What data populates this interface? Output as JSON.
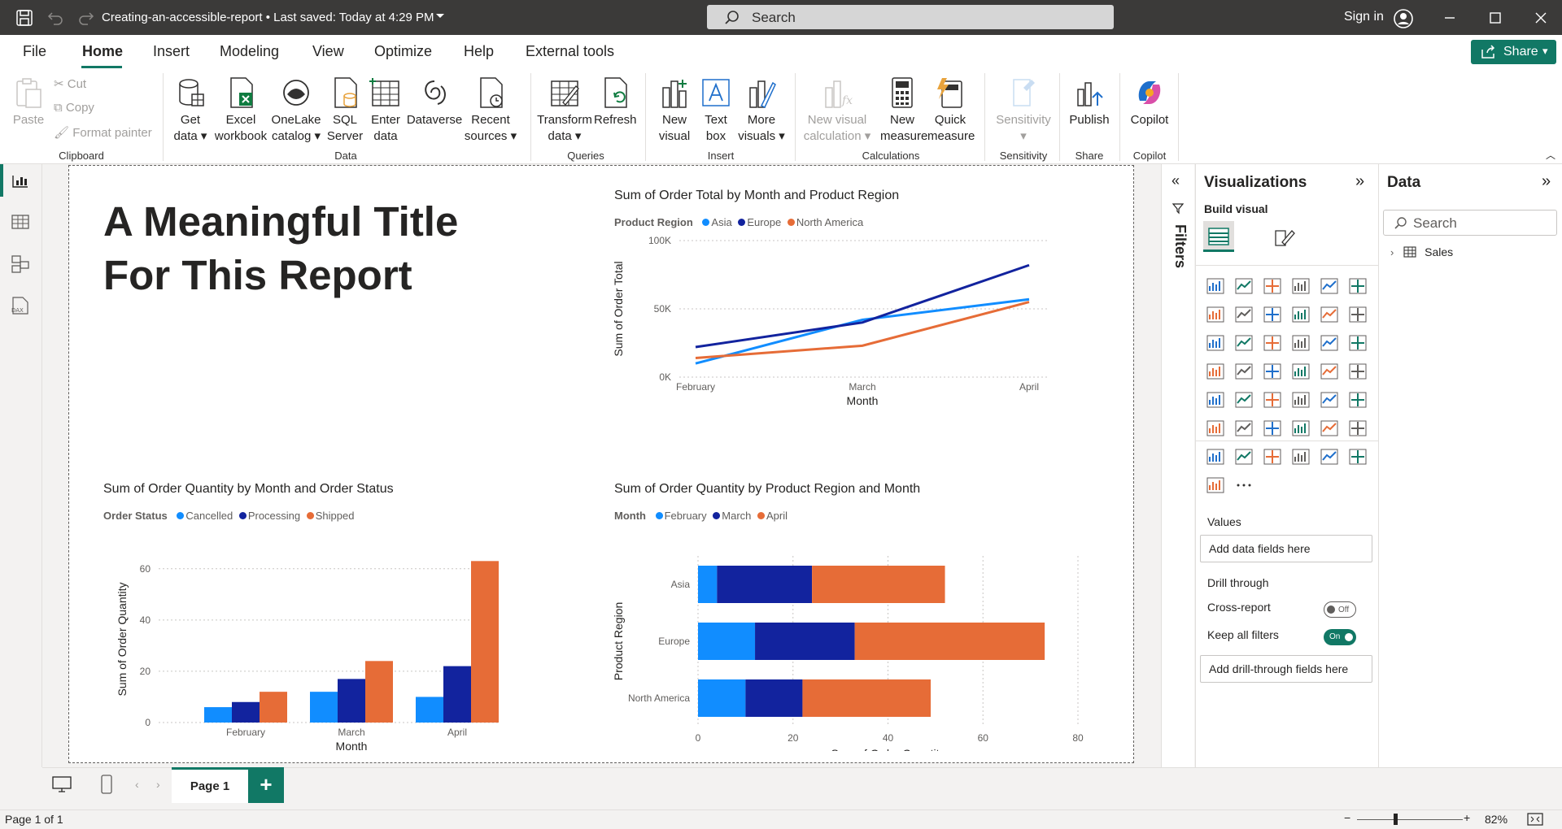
{
  "titlebar": {
    "doc_title": "Creating-an-accessible-report • Last saved: Today at 4:29 PM",
    "search_placeholder": "Search",
    "signin": "Sign in"
  },
  "menu": {
    "items": [
      "File",
      "Home",
      "Insert",
      "Modeling",
      "View",
      "Optimize",
      "Help",
      "External tools"
    ],
    "active": "Home",
    "share_label": "Share"
  },
  "ribbon": {
    "clipboard": {
      "paste": "Paste",
      "cut": "Cut",
      "copy": "Copy",
      "format_painter": "Format painter",
      "group": "Clipboard"
    },
    "data": {
      "get_data": [
        "Get",
        "data ▾"
      ],
      "excel": [
        "Excel",
        "workbook"
      ],
      "onelake": [
        "OneLake",
        "catalog ▾"
      ],
      "sql": [
        "SQL",
        "Server"
      ],
      "enter": [
        "Enter",
        "data"
      ],
      "dataverse": [
        "Dataverse",
        ""
      ],
      "recent": [
        "Recent",
        "sources ▾"
      ],
      "group": "Data"
    },
    "queries": {
      "transform": [
        "Transform",
        "data ▾"
      ],
      "refresh": [
        "Refresh",
        ""
      ],
      "group": "Queries"
    },
    "insert": {
      "new_visual": [
        "New",
        "visual"
      ],
      "text_box": [
        "Text",
        "box"
      ],
      "more_visuals": [
        "More",
        "visuals ▾"
      ],
      "group": "Insert"
    },
    "calculations": {
      "new_visual_calc": [
        "New visual",
        "calculation ▾"
      ],
      "new_measure": [
        "New",
        "measure"
      ],
      "quick_measure": [
        "Quick",
        "measure"
      ],
      "group": "Calculations"
    },
    "sensitivity": {
      "label": [
        "Sensitivity",
        "▾"
      ],
      "group": "Sensitivity"
    },
    "share": {
      "publish": "Publish",
      "group": "Share"
    },
    "copilot": {
      "label": "Copilot",
      "group": "Copilot"
    }
  },
  "report": {
    "title_line1": "A Meaningful Title",
    "title_line2": "For This Report"
  },
  "colors": {
    "series1": "#118DFF",
    "series2": "#12239E",
    "series3": "#E66C37",
    "accent": "#117865"
  },
  "chart_data": [
    {
      "type": "line",
      "title": "Sum of Order Total by Month and Product Region",
      "legend_title": "Product Region",
      "legend_position": "top-left",
      "x": [
        "February",
        "March",
        "April"
      ],
      "xlabel": "Month",
      "ylabel": "Sum of Order Total",
      "ylim": [
        0,
        100000
      ],
      "y_ticks": [
        0,
        50000,
        100000
      ],
      "y_tick_labels": [
        "0K",
        "50K",
        "100K"
      ],
      "series": [
        {
          "name": "Asia",
          "values": [
            10000,
            42000,
            57000
          ]
        },
        {
          "name": "Europe",
          "values": [
            22000,
            40000,
            82000
          ]
        },
        {
          "name": "North America",
          "values": [
            14000,
            23000,
            55000
          ]
        }
      ],
      "grid": true
    },
    {
      "type": "bar",
      "title": "Sum of Order Quantity by Month and Order Status",
      "legend_title": "Order Status",
      "legend_position": "top-left",
      "categories": [
        "February",
        "March",
        "April"
      ],
      "xlabel": "Month",
      "ylabel": "Sum of Order Quantity",
      "ylim": [
        0,
        65
      ],
      "y_ticks": [
        0,
        20,
        40,
        60
      ],
      "series": [
        {
          "name": "Cancelled",
          "values": [
            6,
            12,
            10
          ]
        },
        {
          "name": "Processing",
          "values": [
            8,
            17,
            22
          ]
        },
        {
          "name": "Shipped",
          "values": [
            12,
            24,
            63
          ]
        }
      ],
      "grid": true
    },
    {
      "type": "bar",
      "orientation": "horizontal-stacked",
      "title": "Sum of Order Quantity by Product Region and Month",
      "legend_title": "Month",
      "legend_position": "top-left",
      "categories": [
        "Asia",
        "Europe",
        "North America"
      ],
      "xlabel": "Sum of Order Quantity",
      "ylabel": "Product Region",
      "xlim": [
        0,
        80
      ],
      "x_ticks": [
        0,
        20,
        40,
        60,
        80
      ],
      "series": [
        {
          "name": "February",
          "values": [
            4,
            12,
            10
          ]
        },
        {
          "name": "March",
          "values": [
            20,
            21,
            12
          ]
        },
        {
          "name": "April",
          "values": [
            28,
            40,
            27
          ]
        }
      ],
      "grid": true
    }
  ],
  "filters": {
    "label": "Filters"
  },
  "visualizations": {
    "title": "Visualizations",
    "build_visual": "Build visual",
    "values_label": "Values",
    "values_well": "Add data fields here",
    "drill_through": "Drill through",
    "cross_report": "Cross-report",
    "cross_report_state": "Off",
    "keep_filters": "Keep all filters",
    "keep_filters_state": "On",
    "drill_well": "Add drill-through fields here"
  },
  "data_pane": {
    "title": "Data",
    "search_placeholder": "Search",
    "tables": [
      "Sales"
    ]
  },
  "pages": {
    "tabs": [
      "Page 1"
    ],
    "add": "+"
  },
  "status": {
    "page_info": "Page 1 of 1",
    "zoom": "82%"
  }
}
